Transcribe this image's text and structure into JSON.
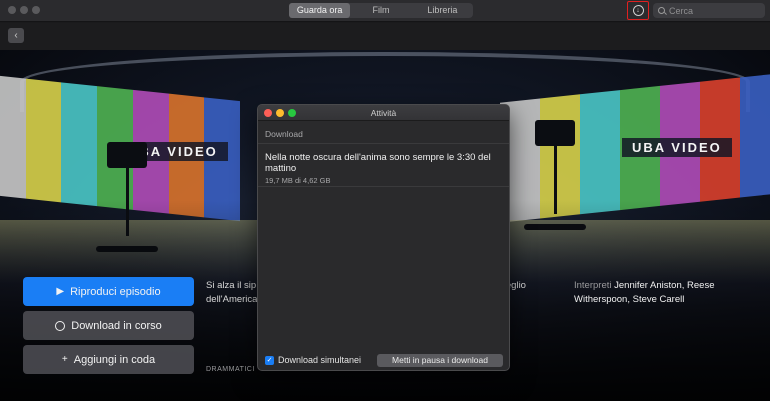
{
  "toolbar": {
    "tabs": [
      {
        "label": "Guarda ora",
        "active": true
      },
      {
        "label": "Film",
        "active": false
      },
      {
        "label": "Libreria",
        "active": false
      }
    ],
    "downloads_icon": "download-progress-icon",
    "search_placeholder": "Cerca"
  },
  "nav": {
    "back_icon": "chevron-left-icon",
    "back_glyph": "‹"
  },
  "hero": {
    "logo_text": "UBA VIDEO"
  },
  "actions": {
    "play_label": "Riproduci episodio",
    "downloading_label": "Download in corso",
    "queue_label": "Aggiungi in coda"
  },
  "details": {
    "description": "Si alza il sip… protagonisti Reese Withe… an filtro, il mondo del l… risveglio dell'America…",
    "cast_label": "Interpreti",
    "cast": "Jennifer Aniston, Reese Witherspoon, Steve Carell",
    "genre": "DRAMMATICI"
  },
  "activity": {
    "title": "Attività",
    "section": "Download",
    "item_title": "Nella notte oscura dell'anima sono sempre le 3:30 del mattino",
    "item_progress": "19,7 MB di 4,62 GB",
    "simultaneous_label": "Download simultanei",
    "simultaneous_checked": true,
    "pause_label": "Metti in pausa i download"
  },
  "colors": {
    "accent": "#1a7ef5",
    "close": "#fe5f57",
    "minimize": "#febc2e",
    "zoom": "#28c840"
  }
}
